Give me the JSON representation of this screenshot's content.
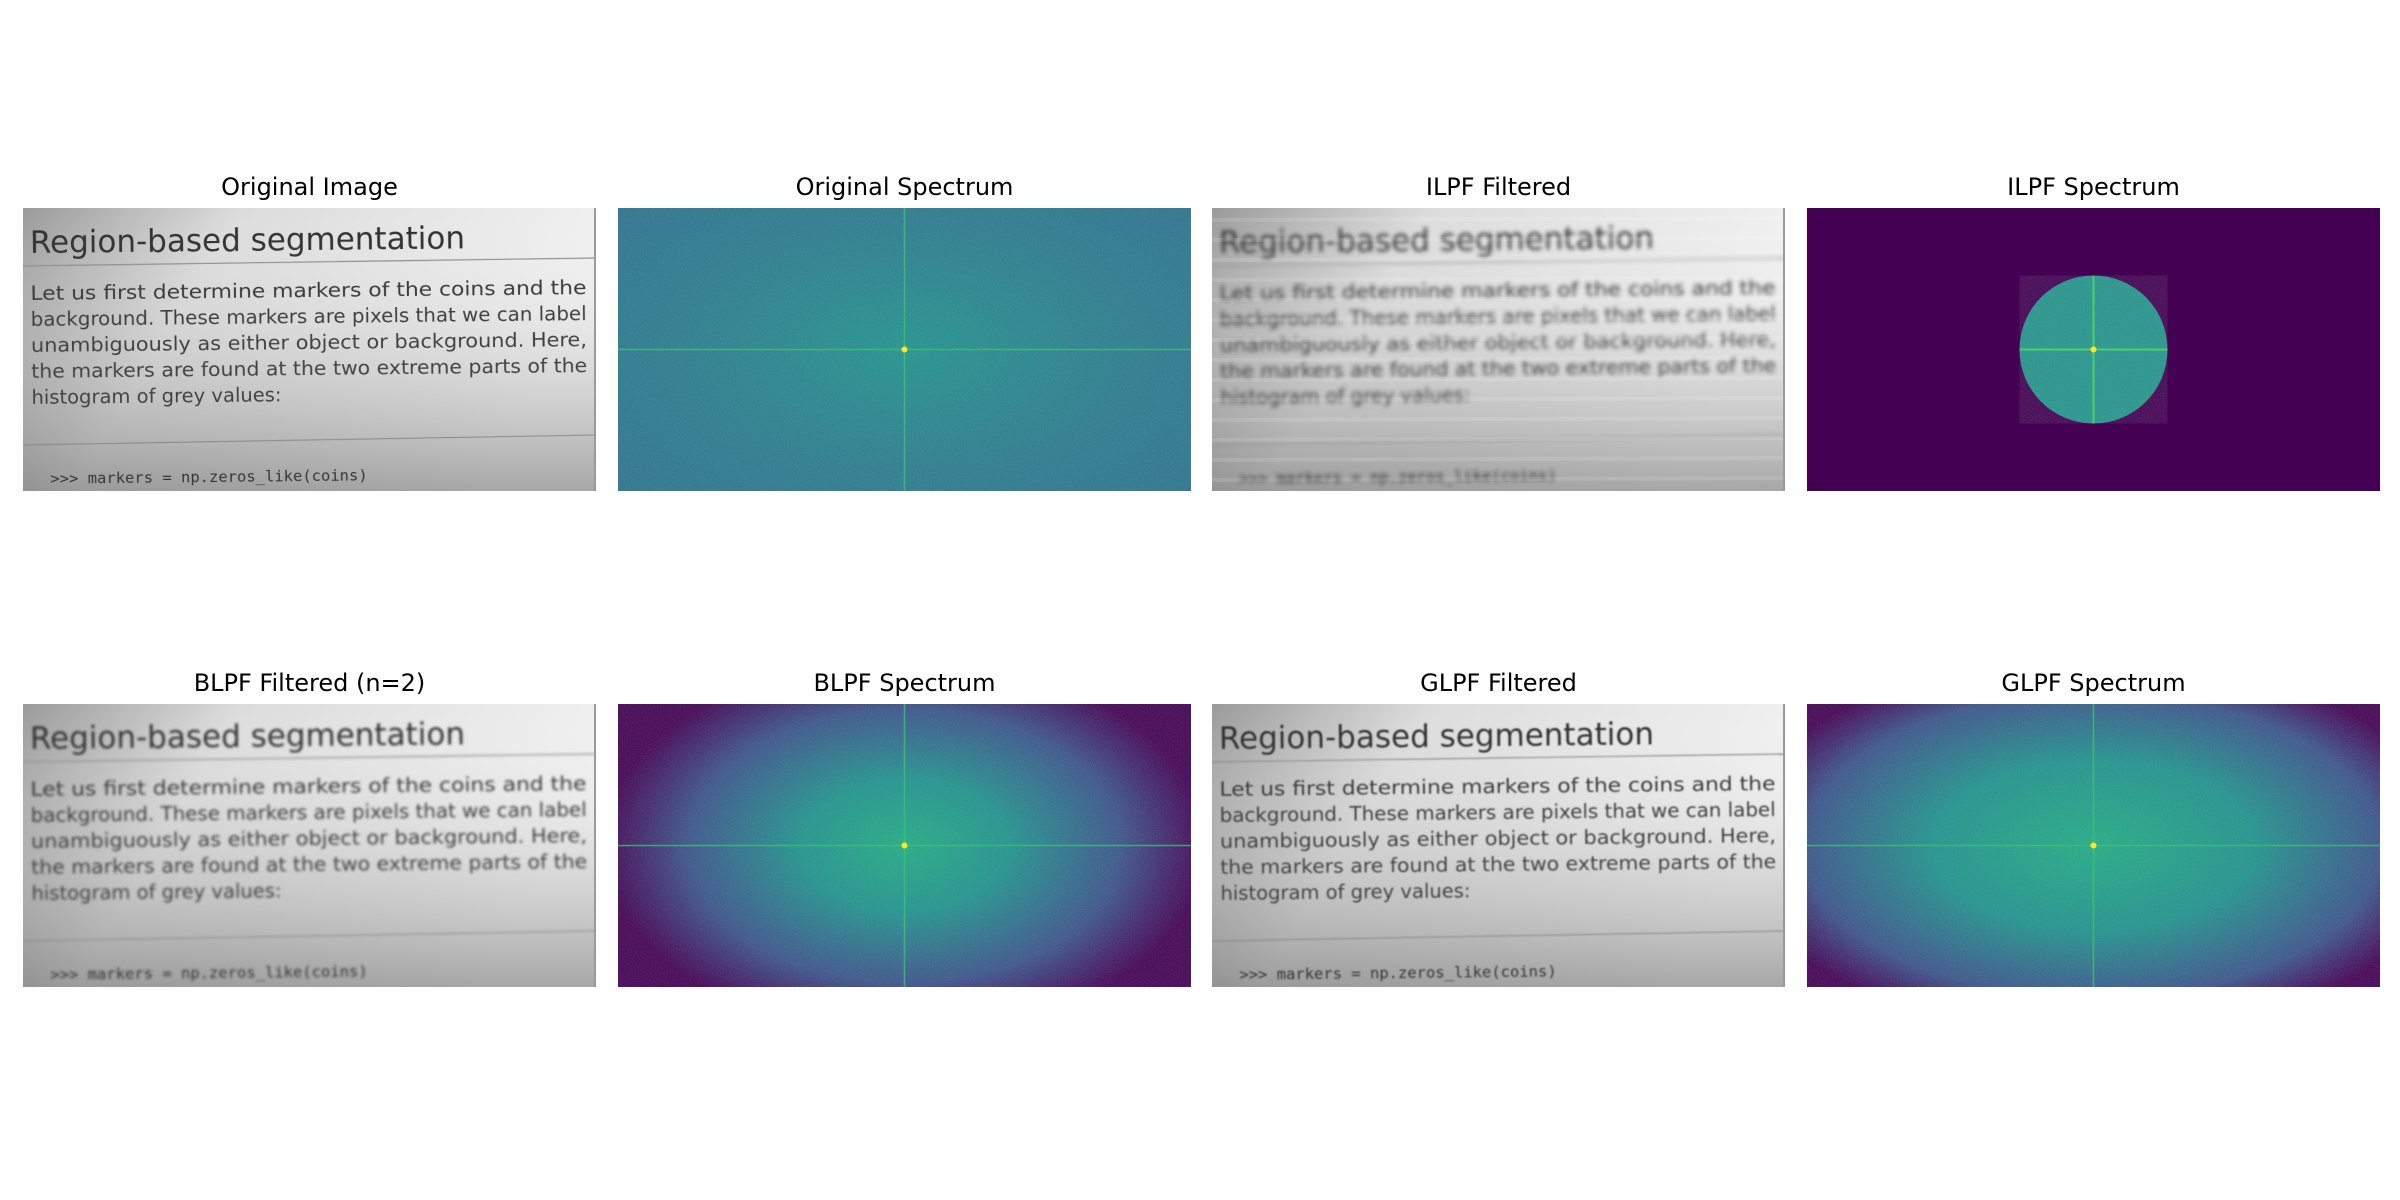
{
  "panels": [
    {
      "title": "Original Image",
      "kind": "document",
      "blur": 0
    },
    {
      "title": "Original Spectrum",
      "kind": "spectrum",
      "variant": "original"
    },
    {
      "title": "ILPF Filtered",
      "kind": "document",
      "blur": 2.2,
      "ringing": true
    },
    {
      "title": "ILPF Spectrum",
      "kind": "spectrum",
      "variant": "ideal"
    },
    {
      "title": "BLPF Filtered (n=2)",
      "kind": "document",
      "blur": 1.4
    },
    {
      "title": "BLPF Spectrum",
      "kind": "spectrum",
      "variant": "butterworth"
    },
    {
      "title": "GLPF Filtered",
      "kind": "document",
      "blur": 0.9
    },
    {
      "title": "GLPF Spectrum",
      "kind": "spectrum",
      "variant": "gaussian"
    }
  ],
  "document": {
    "heading": "Region-based segmentation",
    "lines": [
      "Let us first determine markers of the coins and the",
      "background. These markers are pixels that we can label",
      "unambiguously as either object or background. Here,",
      "the markers are found at the two extreme parts of the",
      "histogram of grey values:"
    ],
    "code": ">>> markers = np.zeros_like(coins)"
  },
  "colors": {
    "viridis_dark": "#440154",
    "viridis_blue": "#2c6f8e",
    "viridis_teal": "#21908d",
    "viridis_green": "#35b779"
  }
}
